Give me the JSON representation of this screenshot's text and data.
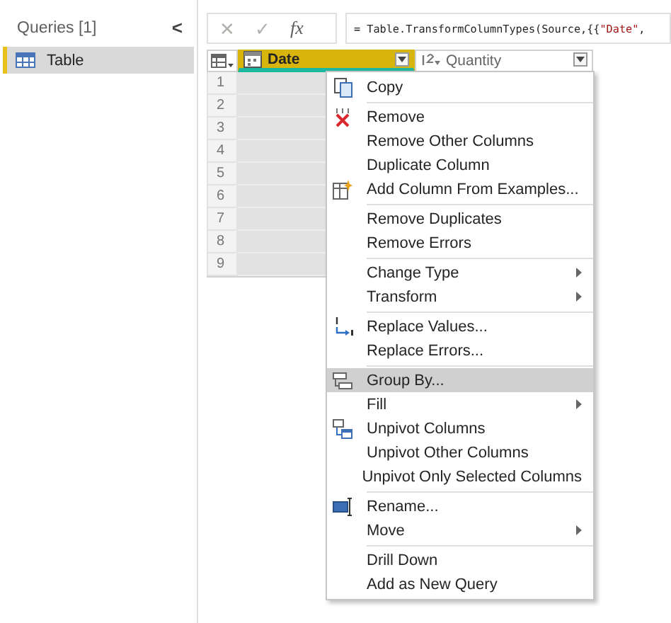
{
  "queries_pane": {
    "title": "Queries [1]",
    "collapse": "<",
    "items": [
      {
        "label": "Table",
        "selected": true
      }
    ]
  },
  "formula_bar": {
    "cancel": "✕",
    "commit": "✓",
    "fx": "fx",
    "formula": [
      {
        "kind": "code",
        "text": "= Table.TransformColumnTypes(Source,{{"
      },
      {
        "kind": "string",
        "text": "\"Date\""
      },
      {
        "kind": "code",
        "text": ","
      }
    ]
  },
  "grid": {
    "columns": [
      {
        "name": "Date",
        "selected": true
      },
      {
        "name": "Quantity",
        "selected": false
      }
    ],
    "rows": [
      "1",
      "2",
      "3",
      "4",
      "5",
      "6",
      "7",
      "8",
      "9"
    ]
  },
  "context_menu": [
    {
      "kind": "item",
      "label": "Copy",
      "submenu": false,
      "selected": false
    },
    {
      "kind": "separator"
    },
    {
      "kind": "item",
      "label": "Remove",
      "submenu": false,
      "selected": false
    },
    {
      "kind": "item",
      "label": "Remove Other Columns",
      "submenu": false,
      "selected": false
    },
    {
      "kind": "item",
      "label": "Duplicate Column",
      "submenu": false,
      "selected": false
    },
    {
      "kind": "item",
      "label": "Add Column From Examples...",
      "submenu": false,
      "selected": false
    },
    {
      "kind": "separator"
    },
    {
      "kind": "item",
      "label": "Remove Duplicates",
      "submenu": false,
      "selected": false
    },
    {
      "kind": "item",
      "label": "Remove Errors",
      "submenu": false,
      "selected": false
    },
    {
      "kind": "separator"
    },
    {
      "kind": "item",
      "label": "Change Type",
      "submenu": true,
      "selected": false
    },
    {
      "kind": "item",
      "label": "Transform",
      "submenu": true,
      "selected": false
    },
    {
      "kind": "separator"
    },
    {
      "kind": "item",
      "label": "Replace Values...",
      "submenu": false,
      "selected": false
    },
    {
      "kind": "item",
      "label": "Replace Errors...",
      "submenu": false,
      "selected": false
    },
    {
      "kind": "separator"
    },
    {
      "kind": "item",
      "label": "Group By...",
      "submenu": false,
      "selected": true
    },
    {
      "kind": "item",
      "label": "Fill",
      "submenu": true,
      "selected": false
    },
    {
      "kind": "item",
      "label": "Unpivot Columns",
      "submenu": false,
      "selected": false
    },
    {
      "kind": "item",
      "label": "Unpivot Other Columns",
      "submenu": false,
      "selected": false
    },
    {
      "kind": "item",
      "label": "Unpivot Only Selected Columns",
      "submenu": false,
      "selected": false
    },
    {
      "kind": "separator"
    },
    {
      "kind": "item",
      "label": "Rename...",
      "submenu": false,
      "selected": false
    },
    {
      "kind": "item",
      "label": "Move",
      "submenu": true,
      "selected": false
    },
    {
      "kind": "separator"
    },
    {
      "kind": "item",
      "label": "Drill Down",
      "submenu": false,
      "selected": false
    },
    {
      "kind": "item",
      "label": "Add as New Query",
      "submenu": false,
      "selected": false
    }
  ]
}
